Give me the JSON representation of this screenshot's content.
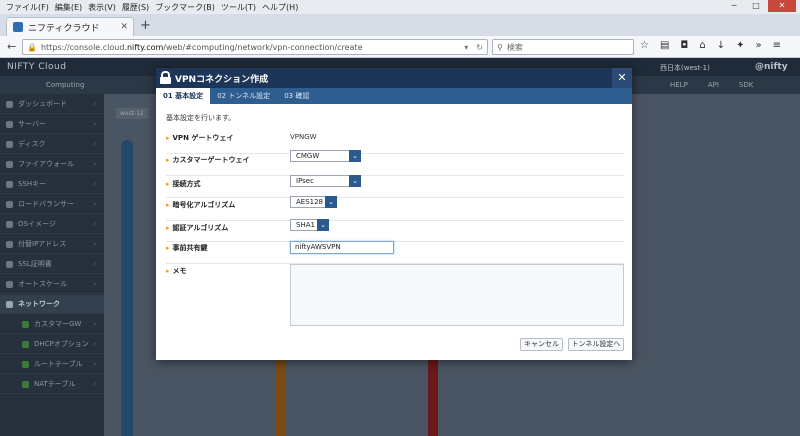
{
  "browser": {
    "menu": [
      "ファイル(F)",
      "編集(E)",
      "表示(V)",
      "履歴(S)",
      "ブックマーク(B)",
      "ツール(T)",
      "ヘルプ(H)"
    ],
    "tab_title": "ニフティクラウド",
    "url_prefix": "https://console.cloud.",
    "url_host": "nifty.com",
    "url_path": "/web/#computing/network/vpn-connection/create",
    "search_placeholder": "検索"
  },
  "app": {
    "logo": "NIFTY Cloud",
    "region": "西日本(west-1)",
    "brand": "@nifty",
    "section": "Computing",
    "top_buttons": [
      "HELP",
      "API",
      "SDK"
    ],
    "zone_tag": "west-12",
    "sidebar": [
      {
        "label": "ダッシュボード"
      },
      {
        "label": "サーバー"
      },
      {
        "label": "ディスク"
      },
      {
        "label": "ファイアウォール"
      },
      {
        "label": "SSHキー"
      },
      {
        "label": "ロードバランサー"
      },
      {
        "label": "OSイメージ"
      },
      {
        "label": "付替IPアドレス"
      },
      {
        "label": "SSL証明書"
      },
      {
        "label": "オートスケール"
      },
      {
        "label": "ネットワーク"
      },
      {
        "label": "カスタマーGW"
      },
      {
        "label": "DHCPオプション"
      },
      {
        "label": "ルートテーブル"
      },
      {
        "label": "NATテーブル"
      }
    ]
  },
  "modal": {
    "title": "VPNコネクション作成",
    "tabs": [
      "01 基本設定",
      "02 トンネル設定",
      "03 確認"
    ],
    "intro": "基本設定を行います。",
    "fields": {
      "vpn_gateway": {
        "label": "VPN ゲートウェイ",
        "value": "VPNGW"
      },
      "customer_gateway": {
        "label": "カスタマーゲートウェイ",
        "value": "CMGW"
      },
      "connection_type": {
        "label": "接続方式",
        "value": "IPsec"
      },
      "encryption": {
        "label": "暗号化アルゴリズム",
        "value": "AES128"
      },
      "auth": {
        "label": "認証アルゴリズム",
        "value": "SHA1"
      },
      "psk": {
        "label": "事前共有鍵",
        "value": "niftyAWSVPN"
      },
      "memo": {
        "label": "メモ",
        "value": ""
      }
    },
    "cancel_label": "キャンセル",
    "next_label": "トンネル設定へ"
  }
}
